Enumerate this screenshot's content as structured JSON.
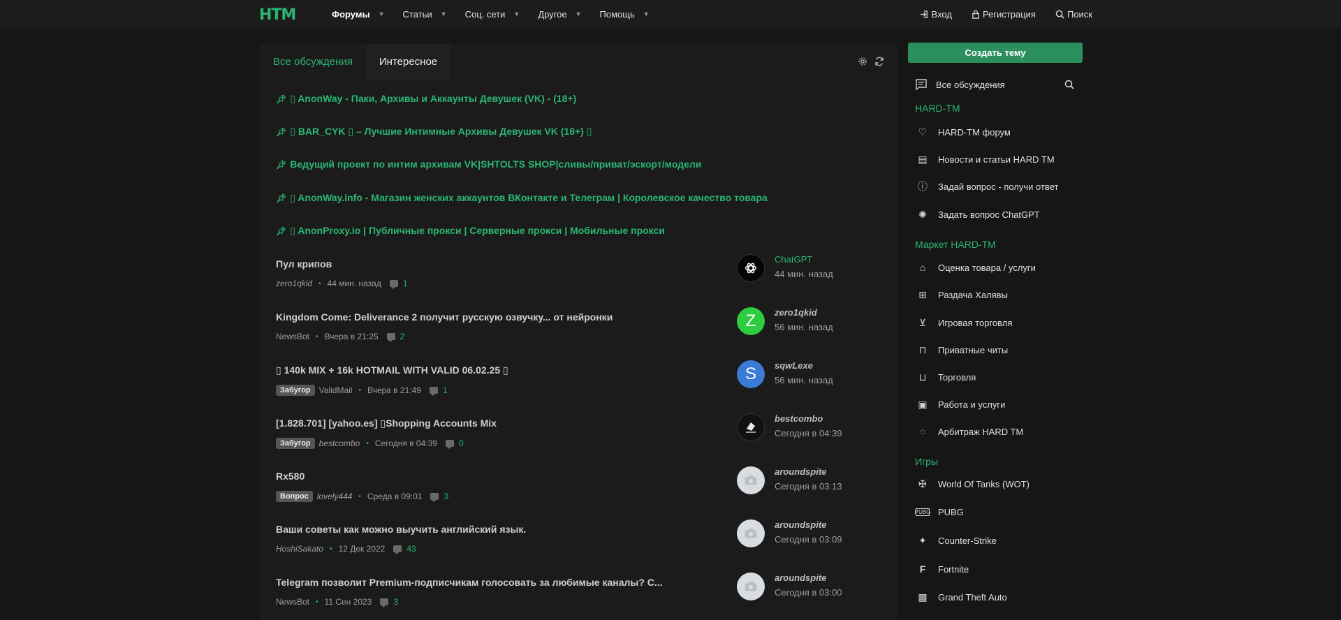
{
  "header": {
    "logo": "HTM",
    "nav": [
      {
        "label": "Форумы",
        "active": true
      },
      {
        "label": "Статьи"
      },
      {
        "label": "Соц. сети"
      },
      {
        "label": "Другое"
      },
      {
        "label": "Помощь"
      }
    ],
    "login": "Вход",
    "register": "Регистрация",
    "search": "Поиск"
  },
  "tabs": {
    "all": "Все обсуждения",
    "interesting": "Интересное"
  },
  "sticky": [
    "▯ AnonWay - Паки, Архивы и Аккаунты Девушек (VK) - (18+)",
    "▯ BAR_CYK ▯ – Лучшие Интимные Архивы Девушек VK (18+) ▯",
    "Ведущий проект по интим архивам VK|SHTOLTS SHOP|сливы/приват/эскорт/модели",
    "▯ AnonWay.info - Магазин женских аккаунтов ВКонтакте и Телеграм | Королевское качество товара",
    "▯ AnonProxy.io | Публичные прокси | Серверные прокси | Мобильные прокси"
  ],
  "threads": [
    {
      "title": "Пул крипов",
      "badge": "",
      "author": "zero1qkid",
      "time": "44 мин. назад",
      "count": "1",
      "last_user": "ChatGPT",
      "last_time": "44 мин. назад"
    },
    {
      "title": "Kingdom Come: Deliverance 2 получит русскую озвучку... от нейронки",
      "badge": "",
      "author": "NewsBot",
      "time": "Вчера в 21:25",
      "count": "2",
      "last_user": "zero1qkid",
      "last_time": "56 мин. назад",
      "avatar_letter": "Z"
    },
    {
      "title": "▯ 140k MIX + 16k HOTMAIL WITH VALID 06.02.25 ▯",
      "badge": "Забугор",
      "author": "ValidMail",
      "time": "Вчера в 21:49",
      "count": "1",
      "last_user": "sqwLexe",
      "last_time": "56 мин. назад",
      "avatar_letter": "S"
    },
    {
      "title": "[1.828.701] [yahoo.es] ▯Shopping Accounts Mix",
      "badge": "Забугор",
      "author": "bestcombo",
      "time": "Сегодня в 04:39",
      "count": "0",
      "last_user": "bestcombo",
      "last_time": "Сегодня в 04:39"
    },
    {
      "title": "Rx580",
      "badge": "Вопрос",
      "author": "lovely444",
      "time": "Среда в 09:01",
      "count": "3",
      "last_user": "aroundspite",
      "last_time": "Сегодня в 03:13"
    },
    {
      "title": "Ваши советы как можно выучить английский язык.",
      "badge": "",
      "author": "HoshiSakato",
      "time": "12 Дек 2022",
      "count": "43",
      "last_user": "aroundspite",
      "last_time": "Сегодня в 03:09"
    },
    {
      "title": "Telegram позволит Premium-подписчикам голосовать за любимые каналы? С...",
      "badge": "",
      "author": "NewsBot",
      "time": "11 Сен 2023",
      "count": "3",
      "last_user": "aroundspite",
      "last_time": "Сегодня в 03:00"
    }
  ],
  "sidebar": {
    "create": "Создать тему",
    "all": "Все обсуждения",
    "sections": [
      {
        "title": "HARD-TM",
        "items": [
          "HARD-TM форум",
          "Новости и статьи HARD TM",
          "Задай вопрос - получи ответ",
          "Задать вопрос ChatGPT"
        ]
      },
      {
        "title": "Маркет HARD-TM",
        "items": [
          "Оценка товара / услуги",
          "Раздача Халявы",
          "Игровая торговля",
          "Приватные читы",
          "Торговля",
          "Работа и услуги",
          "Арбитраж HARD TM"
        ]
      },
      {
        "title": "Игры",
        "items": [
          "World Of Tanks (WOT)",
          "PUBG",
          "Counter-Strike",
          "Fortnite",
          "Grand Theft Auto"
        ]
      }
    ]
  },
  "colors": {
    "accent": "#2bb673",
    "background": "#161616",
    "panel": "#1b1b1b",
    "button": "#2a8f5c"
  }
}
